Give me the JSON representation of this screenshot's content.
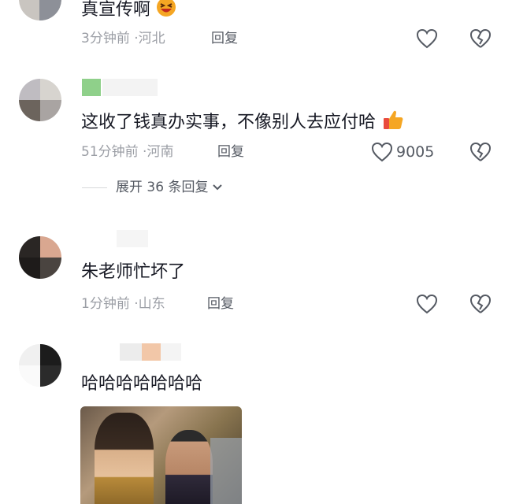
{
  "comments": [
    {
      "text": "真宣传啊",
      "time": "3分钟前",
      "location": "河北",
      "reply_label": "回复",
      "like_count": "",
      "emoji": "grinning-squint-face"
    },
    {
      "text": "这收了钱真办实事，不像别人去应付哈",
      "time": "51分钟前",
      "location": "河南",
      "reply_label": "回复",
      "like_count": "9005",
      "emoji": "thumbs-up",
      "expand_label": "展开 36 条回复"
    },
    {
      "text": "朱老师忙坏了",
      "time": "1分钟前",
      "location": "山东",
      "reply_label": "回复",
      "like_count": ""
    },
    {
      "text": "哈哈哈哈哈哈哈",
      "has_image": true
    }
  ],
  "meta_separator": "·",
  "colors": {
    "text": "#161823",
    "meta": "#9b9ea5",
    "action": "#555a63",
    "emoji_orange": "#f5a623",
    "emoji_red": "#e94b3c"
  }
}
